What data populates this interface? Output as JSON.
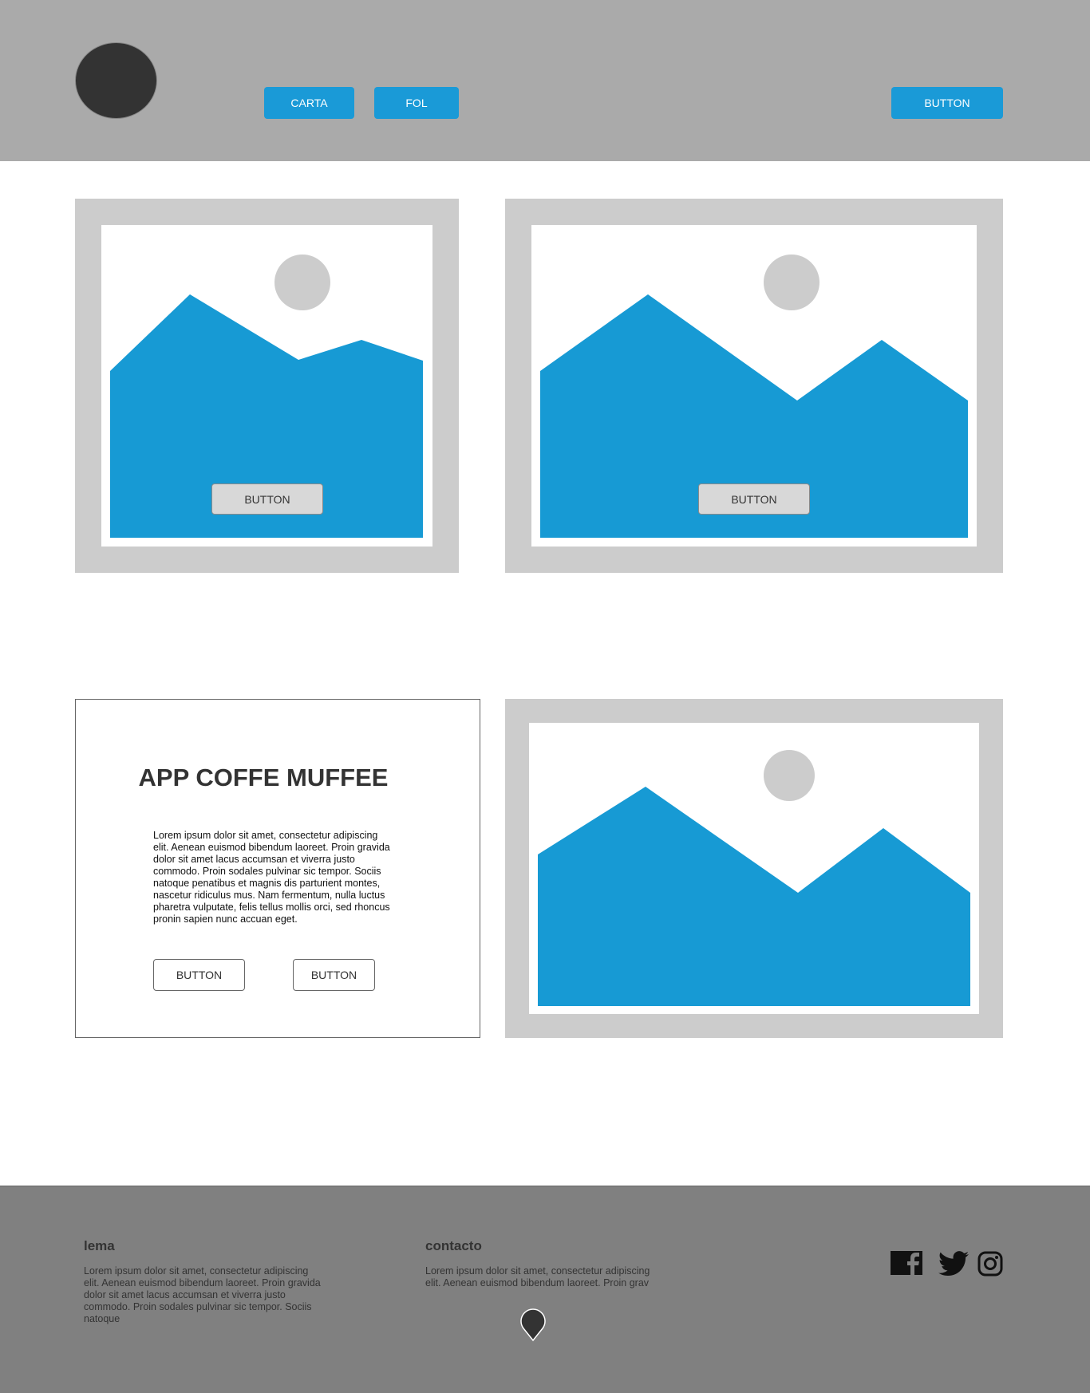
{
  "header": {
    "nav": [
      {
        "label": "CARTA"
      },
      {
        "label": "FOL"
      }
    ],
    "action_button": "BUTTON"
  },
  "cards": [
    {
      "button": "BUTTON"
    },
    {
      "button": "BUTTON"
    }
  ],
  "feature": {
    "title": "APP COFFE MUFFEE",
    "body": "Lorem ipsum dolor sit amet, consectetur adipiscing elit. Aenean euismod bibendum laoreet. Proin gravida dolor sit amet lacus accumsan et viverra justo commodo. Proin sodales pulvinar sic tempor. Sociis natoque penatibus et magnis dis parturient montes, nascetur ridiculus mus. Nam fermentum, nulla luctus pharetra vulputate, felis tellus mollis orci, sed rhoncus pronin sapien nunc accuan eget.",
    "buttons": [
      "BUTTON",
      "BUTTON"
    ]
  },
  "footer": {
    "lema": {
      "heading": "lema",
      "text": "Lorem ipsum dolor sit amet, consectetur adipiscing elit. Aenean euismod bibendum laoreet. Proin gravida dolor sit amet lacus accumsan et viverra justo commodo. Proin sodales pulvinar sic tempor. Sociis natoque"
    },
    "contacto": {
      "heading": "contacto",
      "text": "Lorem ipsum dolor sit amet, consectetur adipiscing elit. Aenean euismod bibendum laoreet. Proin grav"
    },
    "social": [
      "facebook-icon",
      "twitter-icon",
      "instagram-icon"
    ]
  },
  "colors": {
    "header_bg": "#aaaaaa",
    "accent": "#1a9ad7",
    "frame": "#cccccc",
    "footer_bg": "#808080",
    "dark": "#333333"
  }
}
